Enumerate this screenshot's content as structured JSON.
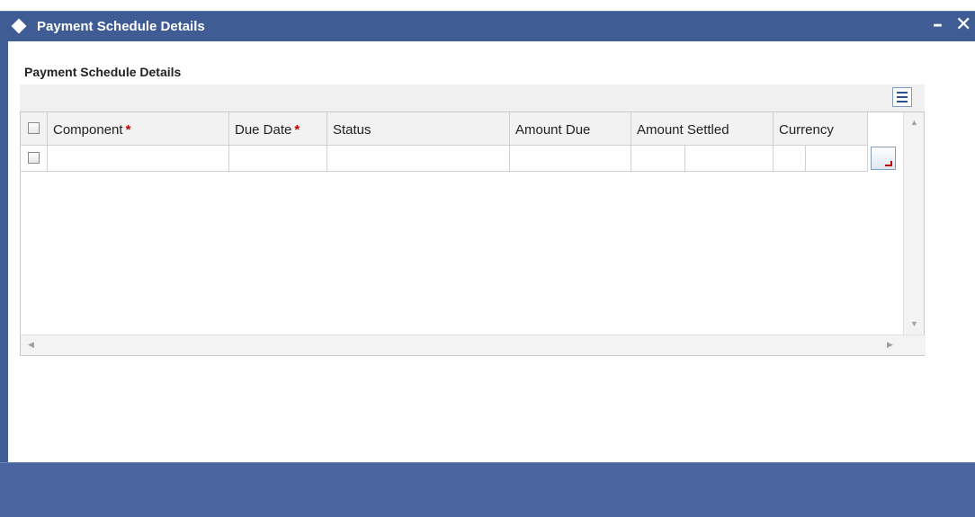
{
  "window": {
    "title": "Payment Schedule Details",
    "minimize_glyph": "–",
    "close_glyph": "✕"
  },
  "section": {
    "title": "Payment Schedule Details"
  },
  "grid": {
    "columns": [
      {
        "label": "Component",
        "required": true
      },
      {
        "label": "Due Date",
        "required": true
      },
      {
        "label": "Status",
        "required": false
      },
      {
        "label": "Amount Due",
        "required": false
      },
      {
        "label": "Amount Settled",
        "required": false
      },
      {
        "label": "Currency",
        "required": false
      }
    ],
    "required_marker": "*",
    "rows": [
      {
        "component": "",
        "due_date": "",
        "status": "",
        "amount_due": "",
        "amount_settled": "",
        "currency": ""
      }
    ]
  },
  "icons": {
    "title": "diamond-icon",
    "toolbar": "single-view-icon",
    "lookup": "row-details-icon",
    "scroll_up": "arrow-up-icon",
    "scroll_down": "arrow-down-icon",
    "scroll_left": "arrow-left-icon",
    "scroll_right": "arrow-right-icon"
  },
  "colors": {
    "titlebar": "#3f5c95",
    "footer": "#4b65a0",
    "required": "#c00000"
  }
}
